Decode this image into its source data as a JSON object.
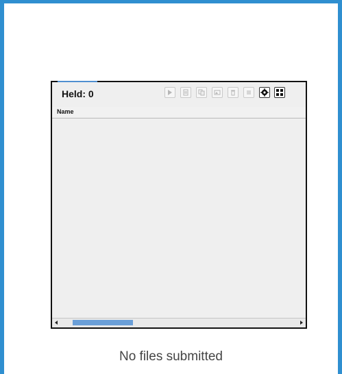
{
  "panel": {
    "held_label": "Held: 0",
    "columns": [
      "Name"
    ],
    "toolbar": [
      {
        "name": "play-icon",
        "enabled": false
      },
      {
        "name": "document-icon",
        "enabled": false
      },
      {
        "name": "copy-icon",
        "enabled": false
      },
      {
        "name": "image-icon",
        "enabled": false
      },
      {
        "name": "trash-icon",
        "enabled": false
      },
      {
        "name": "list-icon",
        "enabled": false
      },
      {
        "name": "gear-icon",
        "enabled": true
      },
      {
        "name": "grid-icon",
        "enabled": true
      }
    ]
  },
  "status": {
    "message": "No files submitted"
  },
  "colors": {
    "frame_border": "#2f8fd0",
    "scroll_thumb": "#6a9fd8"
  }
}
